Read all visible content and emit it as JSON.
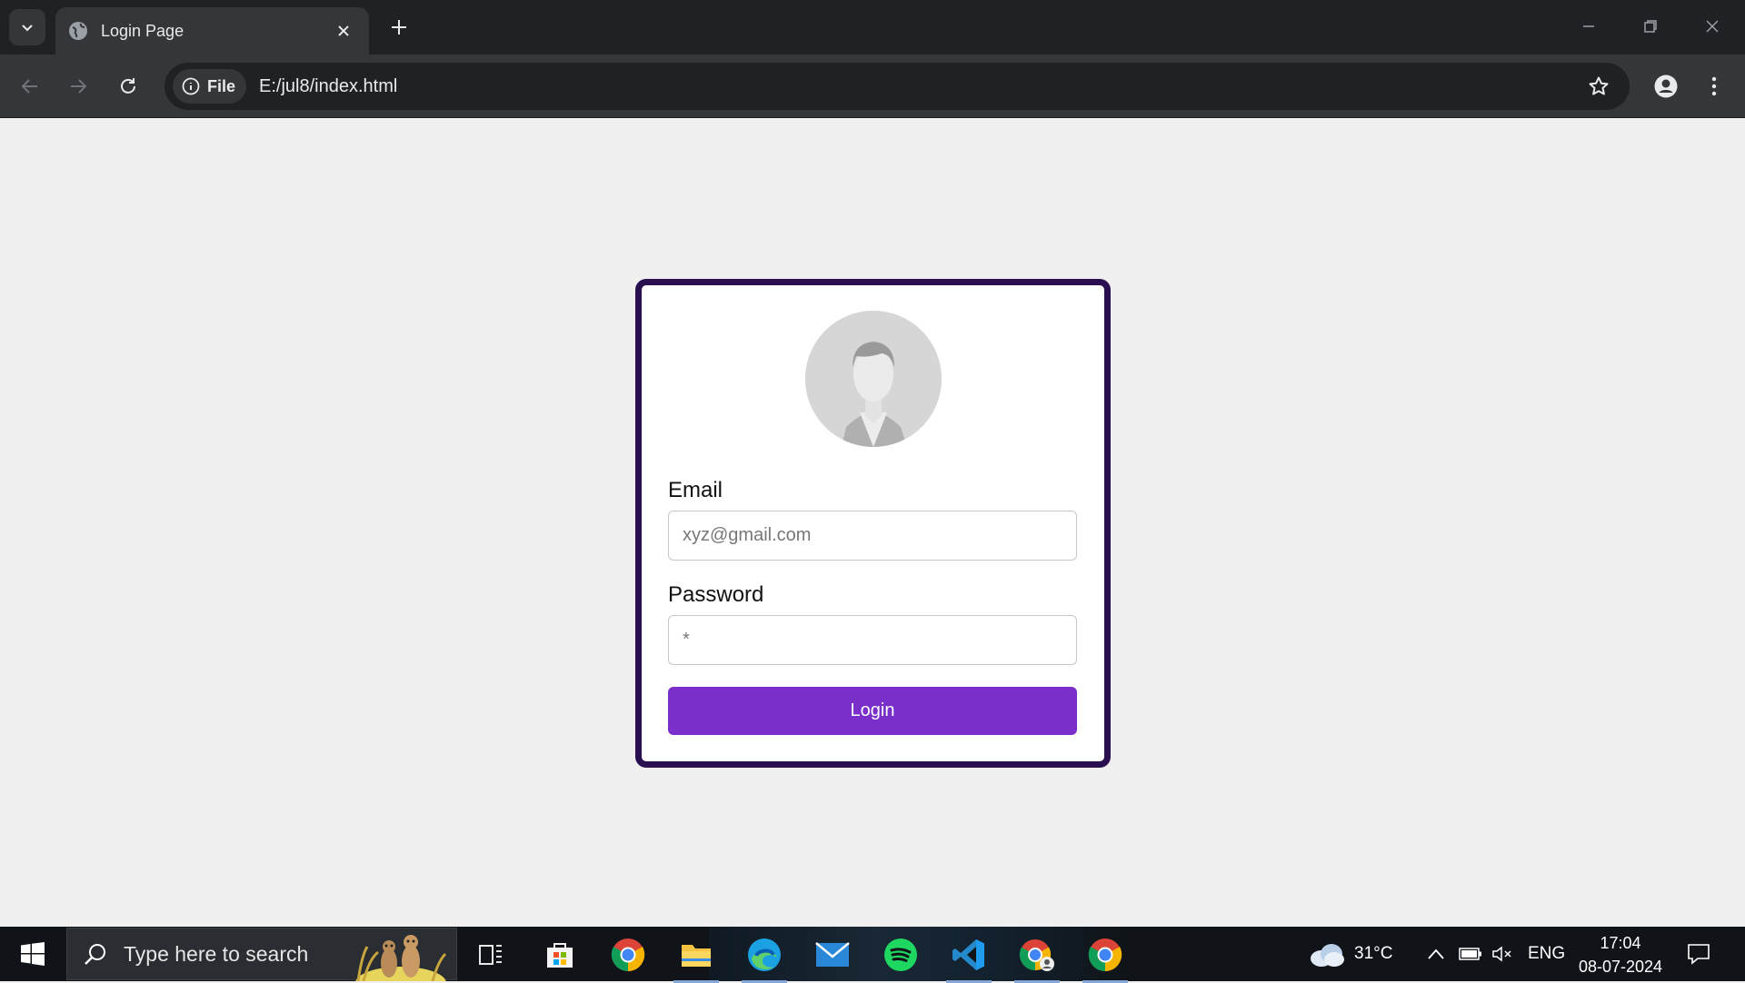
{
  "browser": {
    "tab_title": "Login Page",
    "url_chip": "File",
    "url": "E:/jul8/index.html"
  },
  "login": {
    "email_label": "Email",
    "email_placeholder": "xyz@gmail.com",
    "password_label": "Password",
    "password_placeholder": "*",
    "button_label": "Login",
    "accent_color": "#7a2fcb",
    "border_color": "#2a0f50"
  },
  "taskbar": {
    "search_placeholder": "Type here to search",
    "weather_temp": "31°C",
    "language": "ENG",
    "time": "17:04",
    "date": "08-07-2024",
    "pinned_apps": [
      "microsoft-store",
      "chrome",
      "file-explorer",
      "edge",
      "mail",
      "spotify",
      "vscode",
      "chrome-profile",
      "chrome"
    ]
  }
}
